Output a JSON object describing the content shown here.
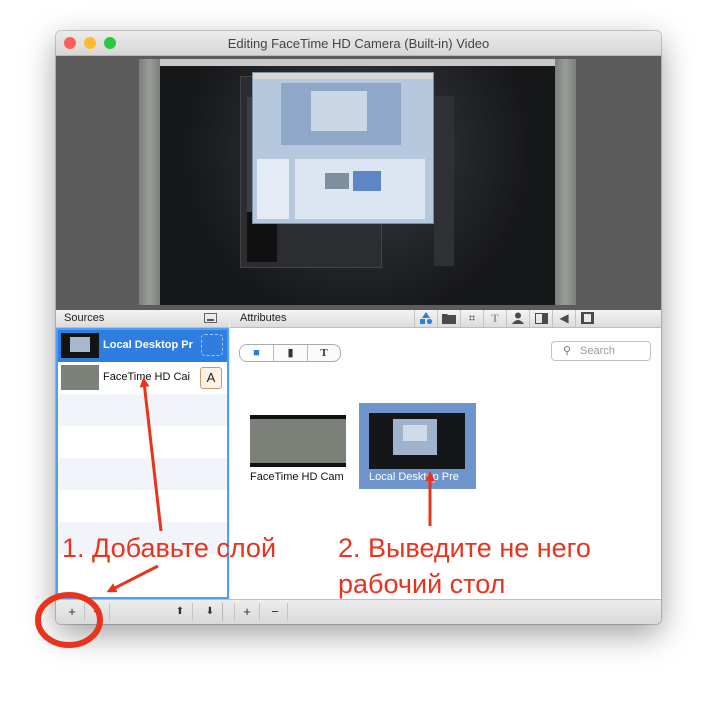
{
  "window": {
    "title": "Editing FaceTime HD Camera (Built-in) Video"
  },
  "colors": {
    "selection": "#2f7de1",
    "focus_ring": "#4e9ef7",
    "annotation": "#e8341d",
    "selected_tile": "#6f94cc"
  },
  "sources_panel": {
    "header": "Sources",
    "items": [
      {
        "label": "Local Desktop Pr",
        "selected": true,
        "thumb": "desktop-thumb"
      },
      {
        "label": "FaceTime HD Cai",
        "selected": false,
        "thumb": "camera-thumb",
        "badge": "A"
      }
    ]
  },
  "attributes_panel": {
    "header": "Attributes",
    "toolbar_icons": [
      "shapes-icon",
      "folder-icon",
      "crop-icon",
      "text-icon",
      "person-icon",
      "split-icon",
      "speaker-icon",
      "film-icon"
    ],
    "tool_glyphs": {
      "crop": "⌗",
      "text": "T",
      "speaker": "◀"
    },
    "segment": {
      "video": "■",
      "document": "▮",
      "text": "T"
    },
    "search_placeholder": "Search",
    "search_glyph": "⚲",
    "tiles": [
      {
        "label": "FaceTime HD Cam",
        "selected": false
      },
      {
        "label": "Local Desktop Pre",
        "selected": true
      }
    ]
  },
  "bottom_bar": {
    "add": "+",
    "remove": "−",
    "move_up": "⬆",
    "move_down": "⬇",
    "add2": "+",
    "remove2": "−"
  },
  "annotations": {
    "step1": "1. Добавьте слой",
    "step2": "2. Выведите не него",
    "step2_line2": "рабочий стол"
  }
}
